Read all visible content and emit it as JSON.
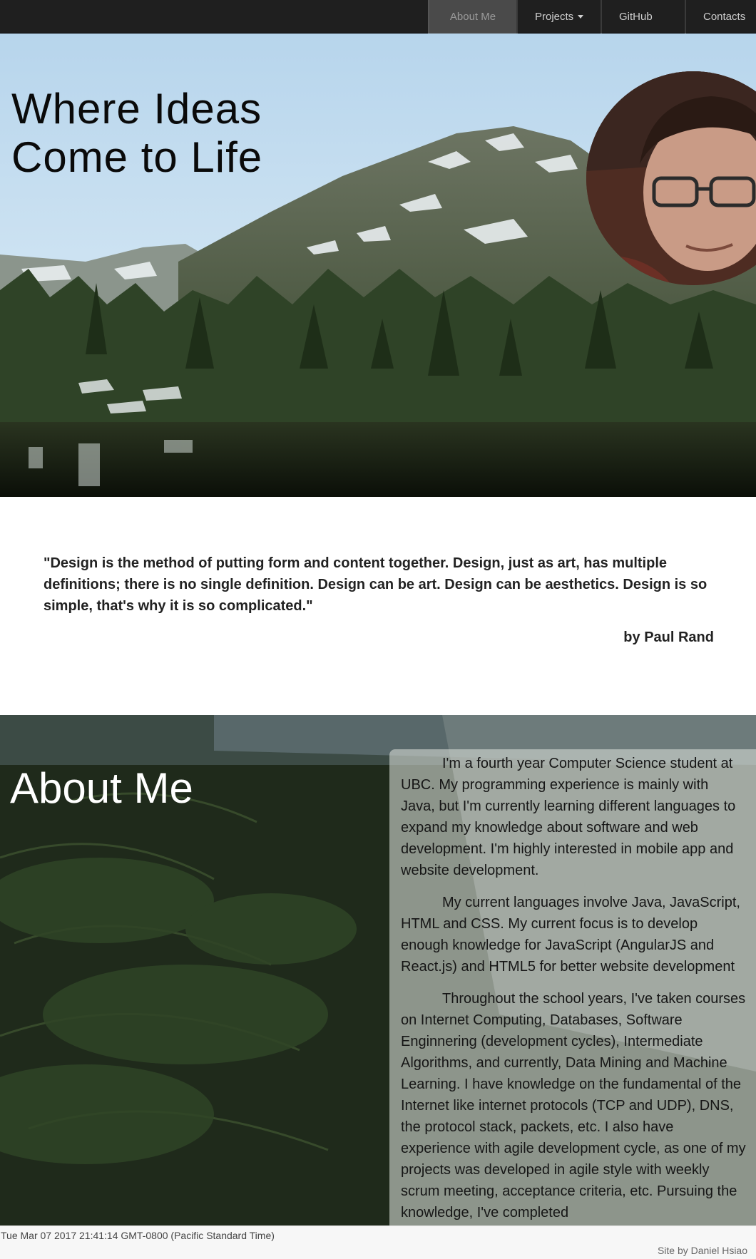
{
  "nav": {
    "items": [
      {
        "label": "About Me",
        "active": true
      },
      {
        "label": "Projects",
        "dropdown": true
      },
      {
        "label": "GitHub"
      },
      {
        "label": "Contacts"
      }
    ]
  },
  "hero": {
    "title": "Where Ideas Come to Life"
  },
  "quote": {
    "text": "\"Design is the method of putting form and content together. Design, just as art, has multiple definitions; there is no single definition. Design can be art. Design can be aesthetics. Design is so simple, that's why it is so complicated.\"",
    "author": "by Paul Rand"
  },
  "about": {
    "title": "About Me",
    "paragraphs": [
      "I'm a fourth year Computer Science student at UBC. My programming experience is mainly with Java, but I'm currently learning different languages to expand my knowledge about software and web development. I'm highly interested in mobile app and website development.",
      "My current languages involve Java, JavaScript, HTML and CSS. My current focus is to develop enough knowledge for JavaScript (AngularJS and React.js) and HTML5 for better website development",
      "Throughout the school years, I've taken courses on Internet Computing, Databases, Software Enginnering (development cycles), Intermediate Algorithms, and currently, Data Mining and Machine Learning. I have knowledge on the fundamental of the Internet like internet protocols (TCP and UDP), DNS, the protocol stack, packets, etc. I also have experience with agile development cycle, as one of my projects was developed in agile style with weekly scrum meeting, acceptance criteria, etc. Pursuing the knowledge, I've completed"
    ]
  },
  "footer": {
    "date": "Tue Mar 07 2017 21:41:14 GMT-0800 (Pacific Standard Time)",
    "credit": "Site by Daniel Hsiao"
  },
  "colors": {
    "navbar": "#1f1f1f",
    "nav_active": "#4a4a4a",
    "footer": "#f7f7f7"
  }
}
